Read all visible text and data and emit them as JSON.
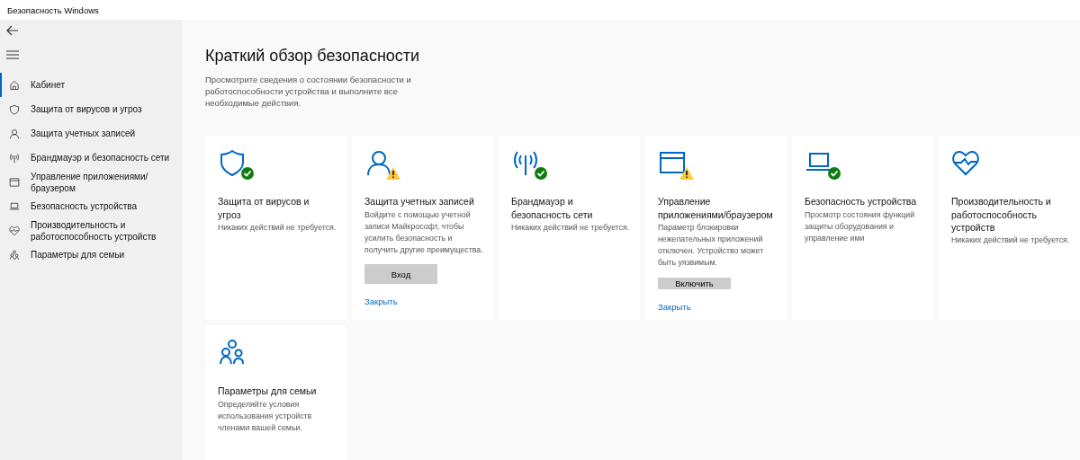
{
  "window": {
    "title": "Безопасность Windows"
  },
  "sidebar": {
    "items": [
      {
        "label": "Кабинет",
        "selected": true
      },
      {
        "label": "Защита от вирусов и угроз",
        "selected": false
      },
      {
        "label": "Защита учетных записей",
        "selected": false
      },
      {
        "label": "Брандмауэр и безопасность сети",
        "selected": false
      },
      {
        "label": "Управление приложениями/браузером",
        "selected": false
      },
      {
        "label": "Безопасность устройства",
        "selected": false
      },
      {
        "label": "Производительность и работоспособность устройств",
        "selected": false
      },
      {
        "label": "Параметры для семьи",
        "selected": false
      }
    ]
  },
  "heading": "Краткий обзор безопасности",
  "intro": "Просмотрите сведения о состоянии безопасности и работоспособности устройства и выполните все необходимые действия.",
  "cards": [
    {
      "title": "Защита от вирусов и угроз",
      "description": "Никаких действий не требуется.",
      "ok": true,
      "warning": false
    },
    {
      "title": "Защита учетных записей",
      "description": "Войдите с помощью учетной записи Майкрософт, чтобы усилить безопасность и получить другие преимущества.",
      "ok": false,
      "warning": true,
      "button": "Вход",
      "link": "Закрыть"
    },
    {
      "title": "Брандмауэр и безопасность сети",
      "description": "Никаких действий не требуется.",
      "ok": true,
      "warning": false
    },
    {
      "title": "Управление приложениями/браузером",
      "description": "Параметр блокировки нежелательных приложений отключен. Устройство может быть уязвимым.",
      "ok": false,
      "warning": true,
      "button": "Включить",
      "link": "Закрыть"
    },
    {
      "title": "Безопасность устройства",
      "description": "Просмотр состояния функций защиты оборудования и управление ими",
      "ok": true,
      "warning": false
    },
    {
      "title": "Производительность и работоспособность устройств",
      "description": "Никаких действий не требуется.",
      "ok": false,
      "warning": false
    },
    {
      "title": "Параметры для семьи",
      "description": "Определяйте условия использования устройств членами вашей семьи.",
      "ok": false,
      "warning": false
    }
  ]
}
